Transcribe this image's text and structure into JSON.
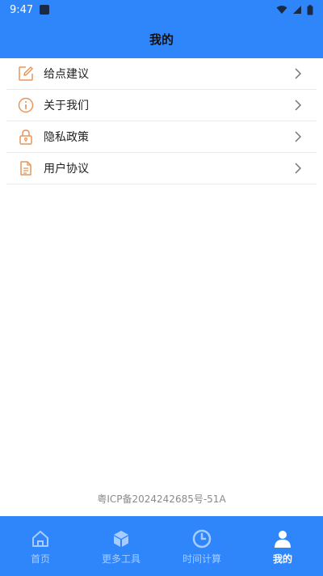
{
  "status_bar": {
    "time": "9:47"
  },
  "header": {
    "title": "我的"
  },
  "menu": [
    {
      "label": "给点建议",
      "icon": "edit-icon"
    },
    {
      "label": "关于我们",
      "icon": "info-icon"
    },
    {
      "label": "隐私政策",
      "icon": "lock-icon"
    },
    {
      "label": "用户协议",
      "icon": "document-icon"
    }
  ],
  "footer": {
    "icp": "粤ICP备2024242685号-51A"
  },
  "tabs": [
    {
      "label": "首页",
      "icon": "home-icon"
    },
    {
      "label": "更多工具",
      "icon": "box-icon"
    },
    {
      "label": "时间计算",
      "icon": "clock-icon"
    },
    {
      "label": "我的",
      "icon": "user-icon",
      "active": true
    }
  ],
  "colors": {
    "primary": "#2f86fb",
    "icon_orange": "#e8955a",
    "tab_inactive": "#a8ccff"
  }
}
